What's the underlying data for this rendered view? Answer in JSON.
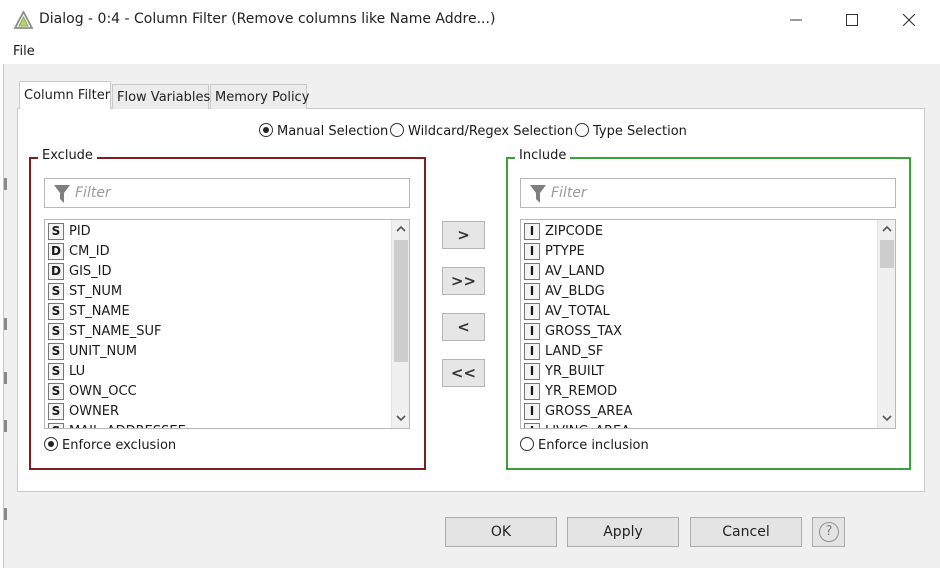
{
  "window": {
    "title": "Dialog - 0:4 - Column Filter (Remove columns like Name Addre...)"
  },
  "menu": {
    "file": "File"
  },
  "tabs": [
    "Column Filter",
    "Flow Variables",
    "Memory Policy"
  ],
  "mode": {
    "options": [
      "Manual Selection",
      "Wildcard/Regex Selection",
      "Type Selection"
    ],
    "selected": "Manual Selection"
  },
  "exclude": {
    "legend": "Exclude",
    "filter_placeholder": "Filter",
    "items": [
      {
        "type": "S",
        "name": "PID"
      },
      {
        "type": "D",
        "name": "CM_ID"
      },
      {
        "type": "D",
        "name": "GIS_ID"
      },
      {
        "type": "S",
        "name": "ST_NUM"
      },
      {
        "type": "S",
        "name": "ST_NAME"
      },
      {
        "type": "S",
        "name": "ST_NAME_SUF"
      },
      {
        "type": "S",
        "name": "UNIT_NUM"
      },
      {
        "type": "S",
        "name": "LU"
      },
      {
        "type": "S",
        "name": "OWN_OCC"
      },
      {
        "type": "S",
        "name": "OWNER"
      },
      {
        "type": "S",
        "name": "MAIL_ADDRESSEE"
      }
    ],
    "enforce_label": "Enforce exclusion",
    "enforce_checked": true
  },
  "include": {
    "legend": "Include",
    "filter_placeholder": "Filter",
    "items": [
      {
        "type": "I",
        "name": "ZIPCODE"
      },
      {
        "type": "I",
        "name": "PTYPE"
      },
      {
        "type": "I",
        "name": "AV_LAND"
      },
      {
        "type": "I",
        "name": "AV_BLDG"
      },
      {
        "type": "I",
        "name": "AV_TOTAL"
      },
      {
        "type": "I",
        "name": "GROSS_TAX"
      },
      {
        "type": "I",
        "name": "LAND_SF"
      },
      {
        "type": "I",
        "name": "YR_BUILT"
      },
      {
        "type": "I",
        "name": "YR_REMOD"
      },
      {
        "type": "I",
        "name": "GROSS_AREA"
      },
      {
        "type": "I",
        "name": "LIVING_AREA"
      }
    ],
    "enforce_label": "Enforce inclusion",
    "enforce_checked": false
  },
  "move_buttons": [
    ">",
    ">>",
    "<",
    "<<"
  ],
  "footer": {
    "ok": "OK",
    "apply": "Apply",
    "cancel": "Cancel",
    "help": "?"
  },
  "colors": {
    "exclude_border": "#7b1f1f",
    "include_border": "#3aa13a",
    "dialog_bg": "#f0f0f0"
  }
}
